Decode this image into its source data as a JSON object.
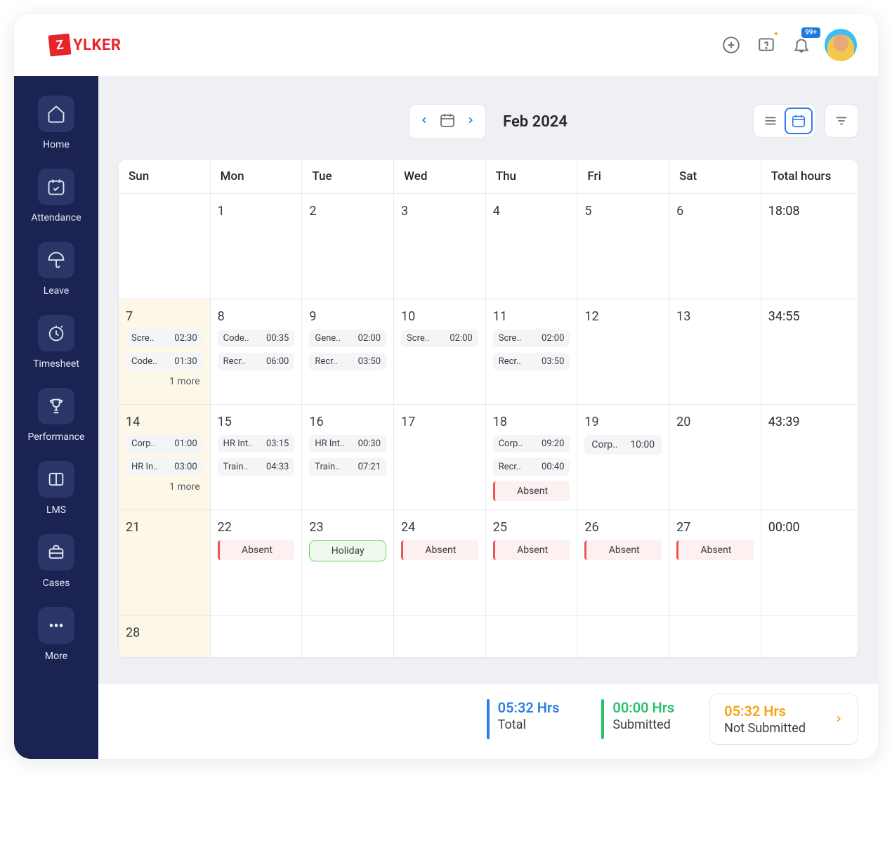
{
  "header": {
    "logo_text": "YLKER",
    "logo_letter": "Z",
    "notification_badge": "99+"
  },
  "sidebar": {
    "items": [
      {
        "label": "Home"
      },
      {
        "label": "Attendance"
      },
      {
        "label": "Leave"
      },
      {
        "label": "Timesheet"
      },
      {
        "label": "Performance"
      },
      {
        "label": "LMS"
      },
      {
        "label": "Cases"
      },
      {
        "label": "More"
      }
    ]
  },
  "toolbar": {
    "month": "Feb 2024"
  },
  "calendar": {
    "day_headers": [
      "Sun",
      "Mon",
      "Tue",
      "Wed",
      "Thu",
      "Fri",
      "Sat",
      "Total hours"
    ],
    "weeks": [
      {
        "days": [
          {
            "num": ""
          },
          {
            "num": "1"
          },
          {
            "num": "2"
          },
          {
            "num": "3"
          },
          {
            "num": "4"
          },
          {
            "num": "5"
          },
          {
            "num": "6"
          }
        ],
        "total": "18:08"
      },
      {
        "days": [
          {
            "num": "7",
            "sun": true,
            "entries": [
              {
                "name": "Scre..",
                "time": "02:30"
              },
              {
                "name": "Code..",
                "time": "01:30"
              }
            ],
            "more": "1 more"
          },
          {
            "num": "8",
            "entries": [
              {
                "name": "Code..",
                "time": "00:35"
              },
              {
                "name": "Recr..",
                "time": "06:00"
              }
            ]
          },
          {
            "num": "9",
            "entries": [
              {
                "name": "Gene..",
                "time": "02:00"
              },
              {
                "name": "Recr..",
                "time": "03:50"
              }
            ]
          },
          {
            "num": "10",
            "entries": [
              {
                "name": "Scre..",
                "time": "02:00"
              }
            ]
          },
          {
            "num": "11",
            "entries": [
              {
                "name": "Scre..",
                "time": "02:00"
              },
              {
                "name": "Recr..",
                "time": "03:50"
              }
            ]
          },
          {
            "num": "12"
          },
          {
            "num": "13"
          }
        ],
        "total": "34:55"
      },
      {
        "days": [
          {
            "num": "14",
            "sun": true,
            "entries": [
              {
                "name": "Corp..",
                "time": "01:00"
              },
              {
                "name": "HR In..",
                "time": "03:00"
              }
            ],
            "more": "1 more"
          },
          {
            "num": "15",
            "entries": [
              {
                "name": "HR Int..",
                "time": "03:15"
              },
              {
                "name": "Train..",
                "time": "04:33"
              }
            ]
          },
          {
            "num": "16",
            "entries": [
              {
                "name": "HR Int..",
                "time": "00:30"
              },
              {
                "name": "Train..",
                "time": "07:21"
              }
            ]
          },
          {
            "num": "17"
          },
          {
            "num": "18",
            "entries": [
              {
                "name": "Corp..",
                "time": "09:20"
              },
              {
                "name": "Recr..",
                "time": "00:40"
              }
            ],
            "absent": "Absent"
          },
          {
            "num": "19",
            "entries_big": [
              {
                "name": "Corp..",
                "time": "10:00"
              }
            ]
          },
          {
            "num": "20"
          }
        ],
        "total": "43:39"
      },
      {
        "days": [
          {
            "num": "21",
            "sun": true
          },
          {
            "num": "22",
            "absent": "Absent"
          },
          {
            "num": "23",
            "holiday": "Holiday"
          },
          {
            "num": "24",
            "absent": "Absent"
          },
          {
            "num": "25",
            "absent": "Absent"
          },
          {
            "num": "26",
            "absent": "Absent"
          },
          {
            "num": "27",
            "absent": "Absent"
          }
        ],
        "total": "00:00"
      },
      {
        "days": [
          {
            "num": "28",
            "sun": false
          },
          {
            "num": ""
          },
          {
            "num": ""
          },
          {
            "num": ""
          },
          {
            "num": ""
          },
          {
            "num": ""
          },
          {
            "num": ""
          }
        ],
        "total": ""
      }
    ]
  },
  "footer": {
    "total_val": "05:32 Hrs",
    "total_lbl": "Total",
    "submitted_val": "00:00 Hrs",
    "submitted_lbl": "Submitted",
    "notsub_val": "05:32 Hrs",
    "notsub_lbl": "Not Submitted"
  }
}
